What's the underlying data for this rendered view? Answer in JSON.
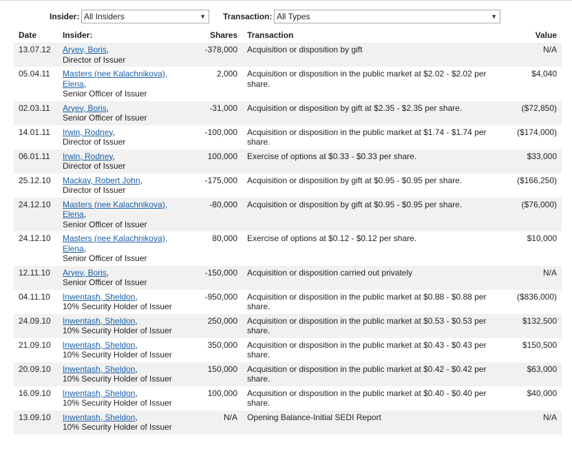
{
  "filters": {
    "insider_label": "Insider:",
    "insider_value": "All Insiders",
    "transaction_label": "Transaction:",
    "transaction_value": "All Types"
  },
  "columns": {
    "date": "Date",
    "insider": "Insider:",
    "shares": "Shares",
    "transaction": "Transaction",
    "value": "Value"
  },
  "rows": [
    {
      "date": "13.07.12",
      "name": "Aryev, Boris",
      "role": "Director of Issuer",
      "shares": "-378,000",
      "transaction": "Acquisition or disposition by gift",
      "value": "N/A"
    },
    {
      "date": "05.04.11",
      "name": "Masters (nee Kalachnikova), Elena",
      "role": "Senior Officer of Issuer",
      "shares": "2,000",
      "transaction": "Acquisition or disposition in the public market at $2.02 - $2.02 per share.",
      "value": "$4,040"
    },
    {
      "date": "02.03.11",
      "name": "Aryev, Boris",
      "role": "Senior Officer of Issuer",
      "shares": "-31,000",
      "transaction": "Acquisition or disposition by gift at $2.35 - $2.35 per share.",
      "value": "($72,850)"
    },
    {
      "date": "14.01.11",
      "name": "Irwin, Rodney",
      "role": "Director of Issuer",
      "shares": "-100,000",
      "transaction": "Acquisition or disposition in the public market at $1.74 - $1.74 per share.",
      "value": "($174,000)"
    },
    {
      "date": "06.01.11",
      "name": "Irwin, Rodney",
      "role": "Director of Issuer",
      "shares": "100,000",
      "transaction": "Exercise of options at $0.33 - $0.33 per share.",
      "value": "$33,000"
    },
    {
      "date": "25.12.10",
      "name": "Mackay, Robert John",
      "role": "Director of Issuer",
      "shares": "-175,000",
      "transaction": "Acquisition or disposition by gift at $0.95 - $0.95 per share.",
      "value": "($166,250)"
    },
    {
      "date": "24.12.10",
      "name": "Masters (nee Kalachnikova), Elena",
      "role": "Senior Officer of Issuer",
      "shares": "-80,000",
      "transaction": "Acquisition or disposition by gift at $0.95 - $0.95 per share.",
      "value": "($76,000)"
    },
    {
      "date": "24.12.10",
      "name": "Masters (nee Kalachnikova), Elena",
      "role": "Senior Officer of Issuer",
      "shares": "80,000",
      "transaction": "Exercise of options at $0.12 - $0.12 per share.",
      "value": "$10,000"
    },
    {
      "date": "12.11.10",
      "name": "Aryev, Boris",
      "role": "Senior Officer of Issuer",
      "shares": "-150,000",
      "transaction": "Acquisition or disposition carried out privately",
      "value": "N/A"
    },
    {
      "date": "04.11.10",
      "name": "Inwentash, Sheldon",
      "role": "10% Security Holder of Issuer",
      "shares": "-950,000",
      "transaction": "Acquisition or disposition in the public market at $0.88 - $0.88 per share.",
      "value": "($836,000)"
    },
    {
      "date": "24.09.10",
      "name": "Inwentash, Sheldon",
      "role": "10% Security Holder of Issuer",
      "shares": "250,000",
      "transaction": "Acquisition or disposition in the public market at $0.53 - $0.53 per share.",
      "value": "$132,500"
    },
    {
      "date": "21.09.10",
      "name": "Inwentash, Sheldon",
      "role": "10% Security Holder of Issuer",
      "shares": "350,000",
      "transaction": "Acquisition or disposition in the public market at $0.43 - $0.43 per share.",
      "value": "$150,500"
    },
    {
      "date": "20.09.10",
      "name": "Inwentash, Sheldon",
      "role": "10% Security Holder of Issuer",
      "shares": "150,000",
      "transaction": "Acquisition or disposition in the public market at $0.42 - $0.42 per share.",
      "value": "$63,000"
    },
    {
      "date": "16.09.10",
      "name": "Inwentash, Sheldon",
      "role": "10% Security Holder of Issuer",
      "shares": "100,000",
      "transaction": "Acquisition or disposition in the public market at $0.40 - $0.40 per share.",
      "value": "$40,000"
    },
    {
      "date": "13.09.10",
      "name": "Inwentash, Sheldon",
      "role": "10% Security Holder of Issuer",
      "shares": "N/A",
      "transaction": "Opening Balance-Initial SEDI Report",
      "value": "N/A"
    }
  ]
}
